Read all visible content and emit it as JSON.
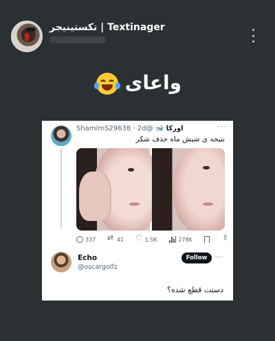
{
  "post": {
    "channel_name": "تکستینیجر | Textinager",
    "caption": "واعای"
  },
  "icons": {
    "caption_emoji": "face-with-tears-of-joy-icon",
    "menu": "more-vertical-icon"
  },
  "tweet": {
    "name": "اورکا 🐋",
    "handle": "@ShamimS29638",
    "time": "· 2d",
    "text": "نتیجه ی شیش ماه حذف شکر",
    "stats": {
      "replies": "337",
      "retweets": "41",
      "likes": "1.5K",
      "views": "278K"
    }
  },
  "reply": {
    "name": "Echo",
    "handle": "@oscargolfz",
    "follow_label": "Follow",
    "text": "دستت قطع شده؟"
  },
  "colors": {
    "background": "#2b3133",
    "card": "#ffffff",
    "text_primary": "#0f1419",
    "text_secondary": "#536471"
  }
}
